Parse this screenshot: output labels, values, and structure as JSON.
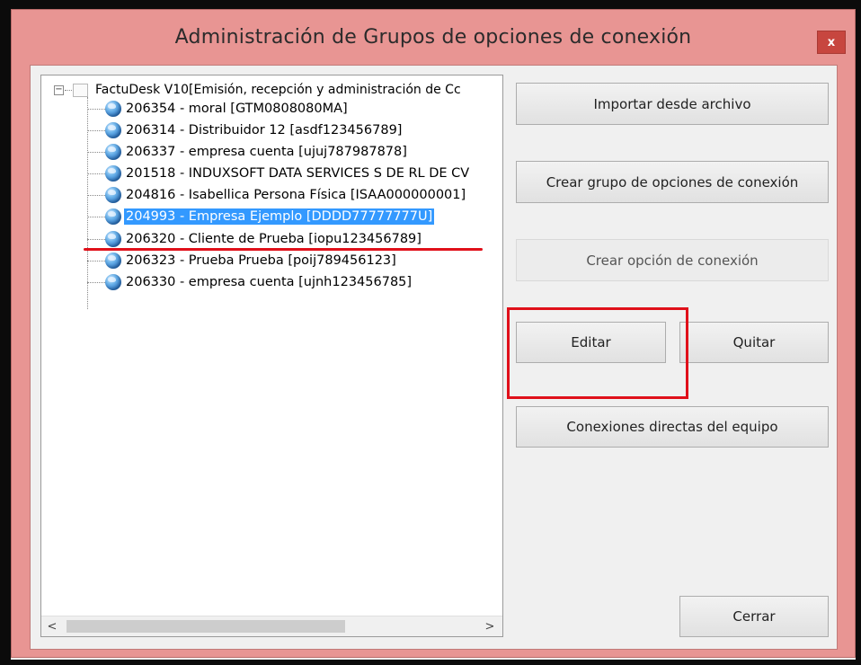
{
  "window": {
    "title": "Administración de Grupos de opciones de conexión",
    "close_label": "x"
  },
  "tree": {
    "root_expander": "−",
    "root_label": "FactuDesk V10[Emisión, recepción y administración de Cc",
    "items": [
      {
        "label": "206354 - moral [GTM0808080MA]",
        "selected": false
      },
      {
        "label": "206314 - Distribuidor 12 [asdf123456789]",
        "selected": false
      },
      {
        "label": "206337 - empresa cuenta [ujuj787987878]",
        "selected": false
      },
      {
        "label": "201518 - INDUXSOFT DATA SERVICES S DE RL DE CV",
        "selected": false
      },
      {
        "label": "204816 - Isabellica Persona Física [ISAA000000001]",
        "selected": false
      },
      {
        "label": "204993 - Empresa Ejemplo [DDDD77777777U]",
        "selected": true
      },
      {
        "label": "206320 - Cliente de Prueba [iopu123456789]",
        "selected": false
      },
      {
        "label": "206323 - Prueba Prueba [poij789456123]",
        "selected": false
      },
      {
        "label": "206330 - empresa cuenta [ujnh123456785]",
        "selected": false
      }
    ],
    "scroll_left": "<",
    "scroll_right": ">"
  },
  "buttons": {
    "import": "Importar desde archivo",
    "create_group": "Crear grupo de opciones de conexión",
    "create_option": "Crear opción de conexión",
    "edit": "Editar",
    "remove": "Quitar",
    "direct_connections": "Conexiones directas del equipo",
    "close": "Cerrar"
  },
  "colors": {
    "window_frame": "#e89593",
    "selection": "#3399ff",
    "annotation_red": "#e0101a"
  },
  "icons": {
    "item_icon": "globe-icon",
    "root_icon": "folder-icon"
  }
}
